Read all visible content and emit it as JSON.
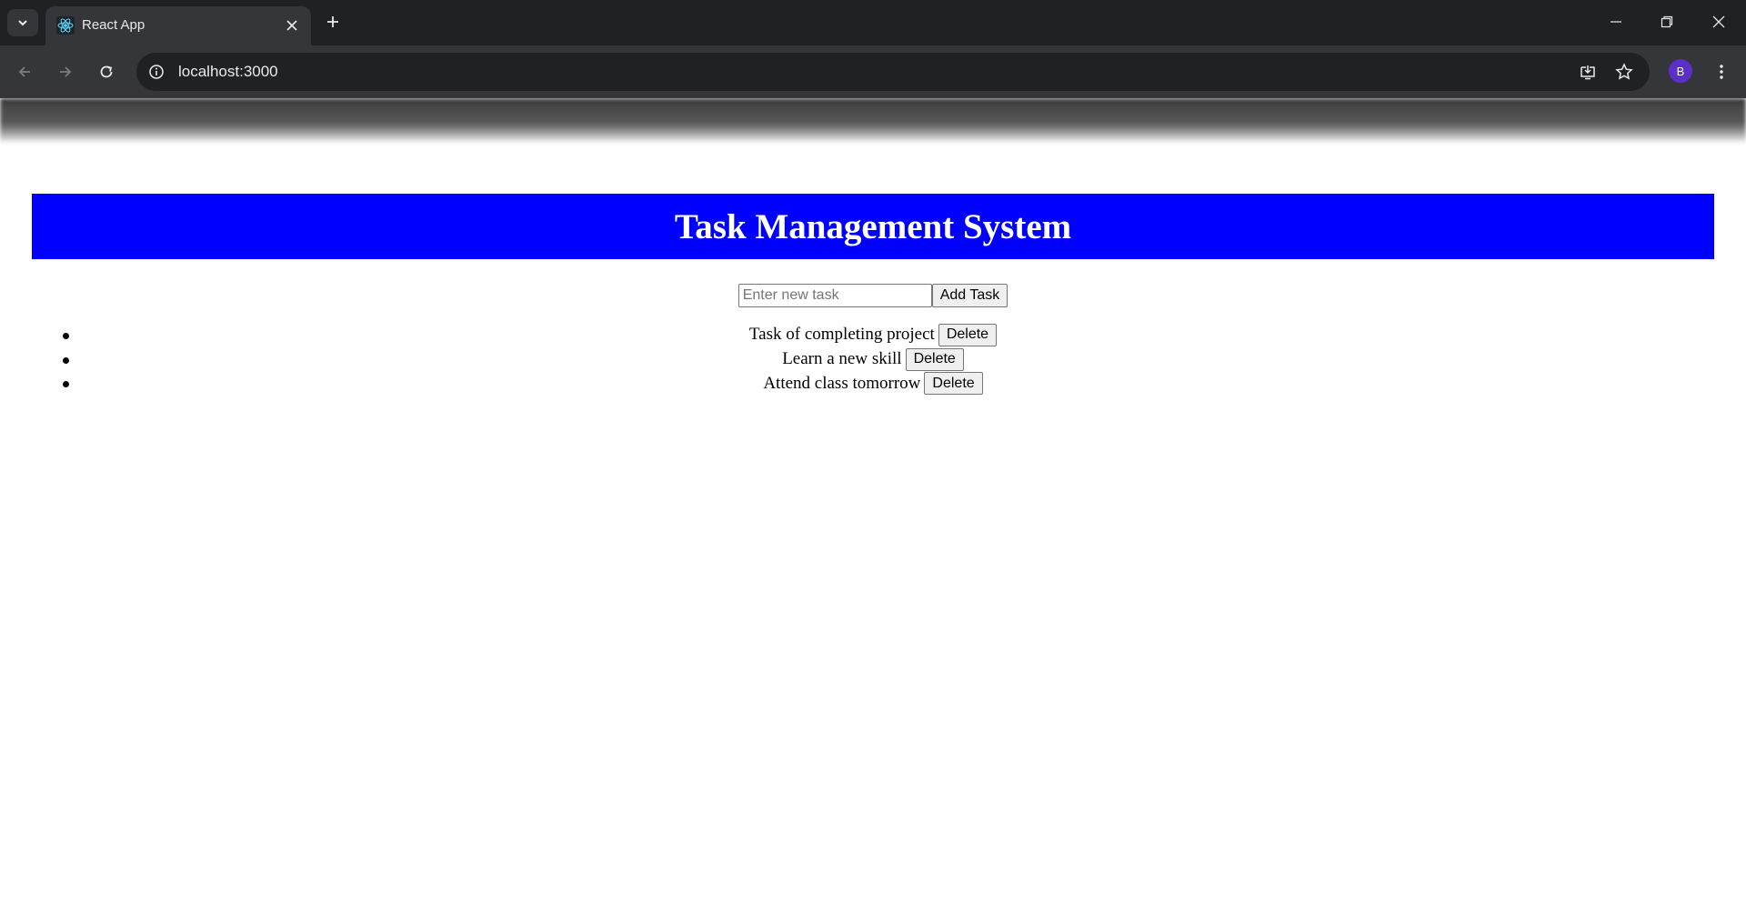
{
  "browser": {
    "tab": {
      "title": "React App"
    },
    "omnibox": {
      "url": "localhost:3000"
    },
    "profile": {
      "initial": "B"
    },
    "icons": {
      "tab_search": "chevron-down-icon",
      "favicon": "react-icon",
      "tab_close": "close-icon",
      "new_tab": "plus-icon",
      "minimize": "minimize-icon",
      "restore": "restore-icon",
      "close_window": "close-icon",
      "back": "arrow-left-icon",
      "forward": "arrow-right-icon",
      "reload": "reload-icon",
      "site_info": "info-icon",
      "install": "install-app-icon",
      "bookmark": "star-icon",
      "menu": "kebab-menu-icon"
    }
  },
  "app": {
    "title": "Task Management System",
    "header_color": "#0000ff",
    "input": {
      "placeholder": "Enter new task",
      "value": ""
    },
    "add_button_label": "Add Task",
    "tasks": [
      {
        "text": "Task of completing project",
        "delete_label": "Delete"
      },
      {
        "text": "Learn a new skill",
        "delete_label": "Delete"
      },
      {
        "text": "Attend class tomorrow",
        "delete_label": "Delete"
      }
    ]
  }
}
